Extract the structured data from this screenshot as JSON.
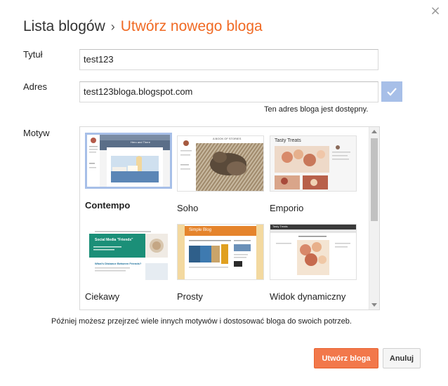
{
  "header": {
    "breadcrumb_parent": "Lista blogów",
    "separator": "›",
    "current": "Utwórz nowego bloga",
    "close_glyph": "×"
  },
  "form": {
    "title_label": "Tytuł",
    "title_value": "test123",
    "address_label": "Adres",
    "address_value": "test123bloga.blogspot.com",
    "address_status": "Ten adres bloga jest dostępny.",
    "theme_label": "Motyw"
  },
  "themes": [
    {
      "name": "Contempo",
      "selected": true
    },
    {
      "name": "Soho",
      "selected": false
    },
    {
      "name": "Emporio",
      "selected": false
    },
    {
      "name": "Ciekawy",
      "selected": false
    },
    {
      "name": "Prosty",
      "selected": false
    },
    {
      "name": "Widok dynamiczny",
      "selected": false
    }
  ],
  "thumb_text": {
    "contempo_header": "Hero and There",
    "soho_header": "A BOOK OF STORIES",
    "emporio_header": "Tasty Treats",
    "ciekawy_header": "Social Media \"Friends\"",
    "ciekawy_subheader": "What's Distance Between Friends?",
    "prosty_header": "Simple Blog",
    "dynamic_header": "Tasty Treats"
  },
  "hint": "Później możesz przejrzeć wiele innych motywów i dostosować bloga do swoich potrzeb.",
  "actions": {
    "create_label": "Utwórz bloga",
    "cancel_label": "Anuluj"
  },
  "colors": {
    "accent_orange": "#f06a24",
    "primary_button": "#f2784b",
    "selection_blue": "#a7bfe8"
  }
}
